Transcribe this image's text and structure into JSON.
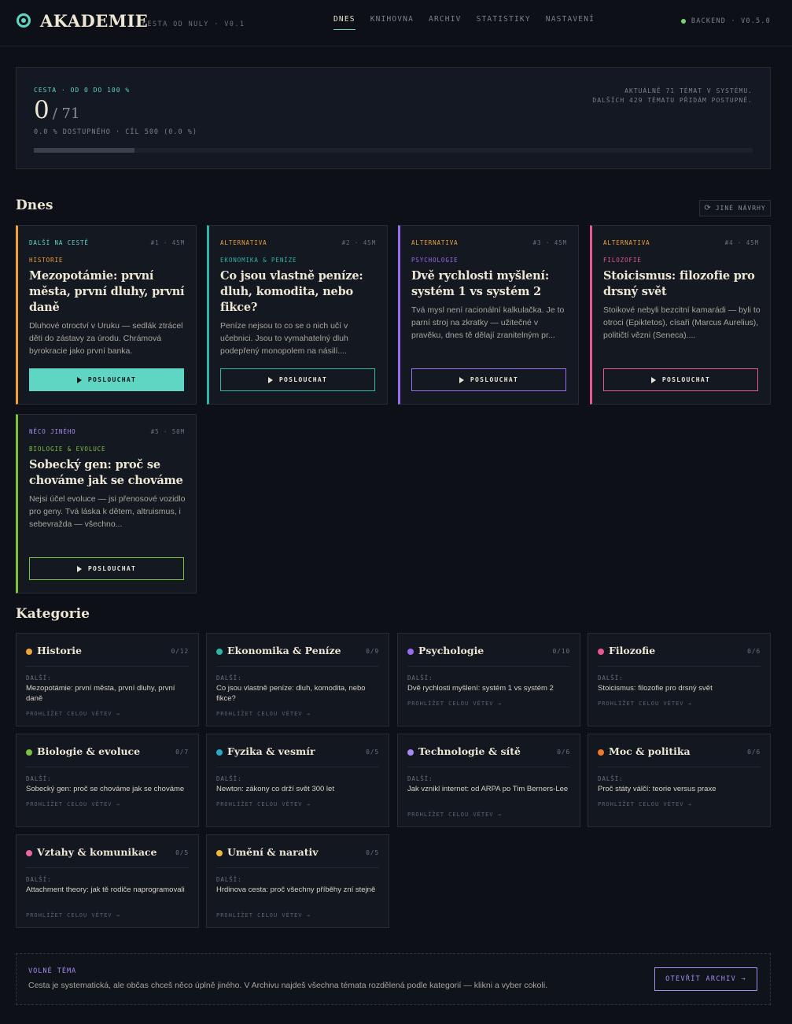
{
  "header": {
    "logo": "AKADEMIE",
    "tagline": "CESTA OD NULY · V0.1",
    "nav": [
      "DNES",
      "KNIHOVNA",
      "ARCHIV",
      "STATISTIKY",
      "NASTAVENÍ"
    ],
    "backend": "BACKEND · V0.5.0"
  },
  "progress": {
    "label": "CESTA · OD 0 DO 100 %",
    "current": "0",
    "total": "/ 71",
    "sub": "0.0 % DOSTUPNÉHO · CÍL 500 (0.0 %)",
    "note_line1": "AKTUÁLNĚ 71 TÉMAT V SYSTÉMU.",
    "note_line2": "DALŠÍCH 429 TÉMATU PŘIDÁM POSTUPNĚ.",
    "fill_fraction": 0.14
  },
  "today": {
    "title": "Dnes",
    "other_button": "JINÉ NÁVRHY",
    "cards": [
      {
        "tag": "DALŠÍ NA CESTĚ",
        "meta": "#1 · 45M",
        "category": "HISTORIE",
        "title": "Mezopotámie: první města, první dluhy, první daně",
        "desc": "Dluhové otroctví v Uruku — sedlák ztrácel děti do zástavy za úrodu. Chrámová byrokracie jako první banka.",
        "button": "POSLOUCHAT",
        "accent": "#f0a238",
        "tag_color": "#5fd6c4"
      },
      {
        "tag": "ALTERNATIVA",
        "meta": "#2 · 45M",
        "category": "EKONOMIKA & PENÍZE",
        "title": "Co jsou vlastně peníze: dluh, komodita, nebo fikce?",
        "desc": "Peníze nejsou to co se o nich učí v učebnici. Jsou to vymahatelný dluh podepřený monopolem na násilí....",
        "button": "POSLOUCHAT",
        "accent": "#2fb5a8",
        "tag_color": "#f0a238"
      },
      {
        "tag": "ALTERNATIVA",
        "meta": "#3 · 45M",
        "category": "PSYCHOLOGIE",
        "title": "Dvě rychlosti myšlení: systém 1 vs systém 2",
        "desc": "Tvá mysl není racionální kalkulačka. Je to parní stroj na zkratky — užitečné v pravěku, dnes tě dělají zranitelným pr...",
        "button": "POSLOUCHAT",
        "accent": "#9a6cf0",
        "tag_color": "#f0a238"
      },
      {
        "tag": "ALTERNATIVA",
        "meta": "#4 · 45M",
        "category": "FILOZOFIE",
        "title": "Stoicismus: filozofie pro drsný svět",
        "desc": "Stoikové nebyli bezcitní kamarádi — byli to otroci (Epiktetos), císaři (Marcus Aurelius), političtí vězni (Seneca)....",
        "button": "POSLOUCHAT",
        "accent": "#e8578f",
        "tag_color": "#f0a238"
      },
      {
        "tag": "NĚCO JINÉHO",
        "meta": "#5 · 50M",
        "category": "BIOLOGIE & EVOLUCE",
        "title": "Sobecký gen: proč se chováme jak se chováme",
        "desc": "Nejsi účel evoluce — jsi přenosové vozidlo pro geny. Tvá láska k dětem, altruismus, i sebevražda — všechno...",
        "button": "POSLOUCHAT",
        "accent": "#7cc23e",
        "tag_color": "#a58cf0"
      }
    ]
  },
  "categories": {
    "title": "Kategorie",
    "next_label": "DALŠÍ:",
    "browse_label": "PROHLÍŽET CELOU VĚTEV →",
    "items": [
      {
        "name": "Historie",
        "count": "0/12",
        "next": "Mezopotámie: první města, první dluhy, první daně",
        "accent": "#f0a238"
      },
      {
        "name": "Ekonomika & Peníze",
        "count": "0/9",
        "next": "Co jsou vlastně peníze: dluh, komodita, nebo fikce?",
        "accent": "#2fb5a8"
      },
      {
        "name": "Psychologie",
        "count": "0/10",
        "next": "Dvě rychlosti myšlení: systém 1 vs systém 2",
        "accent": "#9a6cf0"
      },
      {
        "name": "Filozofie",
        "count": "0/6",
        "next": "Stoicismus: filozofie pro drsný svět",
        "accent": "#e8578f"
      },
      {
        "name": "Biologie & evoluce",
        "count": "0/7",
        "next": "Sobecký gen: proč se chováme jak se chováme",
        "accent": "#7cc23e"
      },
      {
        "name": "Fyzika & vesmír",
        "count": "0/5",
        "next": "Newton: zákony co drží svět 300 let",
        "accent": "#2aa8c8"
      },
      {
        "name": "Technologie & sítě",
        "count": "0/6",
        "next": "Jak vznikl internet: od ARPA po Tim Berners-Lee",
        "accent": "#a58cf0"
      },
      {
        "name": "Moc & politika",
        "count": "0/6",
        "next": "Proč státy válčí: teorie versus praxe",
        "accent": "#f07a2c"
      },
      {
        "name": "Vztahy & komunikace",
        "count": "0/5",
        "next": "Attachment theory: jak tě rodiče naprogramovali",
        "accent": "#e8689f"
      },
      {
        "name": "Umění & narativ",
        "count": "0/5",
        "next": "Hrdinova cesta: proč všechny příběhy zní stejně",
        "accent": "#f0b838"
      }
    ]
  },
  "free_topic": {
    "label": "VOLNÉ TÉMA",
    "text": "Cesta je systematická, ale občas chceš něco úplně jiného. V Archivu najdeš všechna témata rozdělená podle kategorií — klikni a vyber cokoli.",
    "button": "OTEVŘÍT ARCHIV →"
  }
}
